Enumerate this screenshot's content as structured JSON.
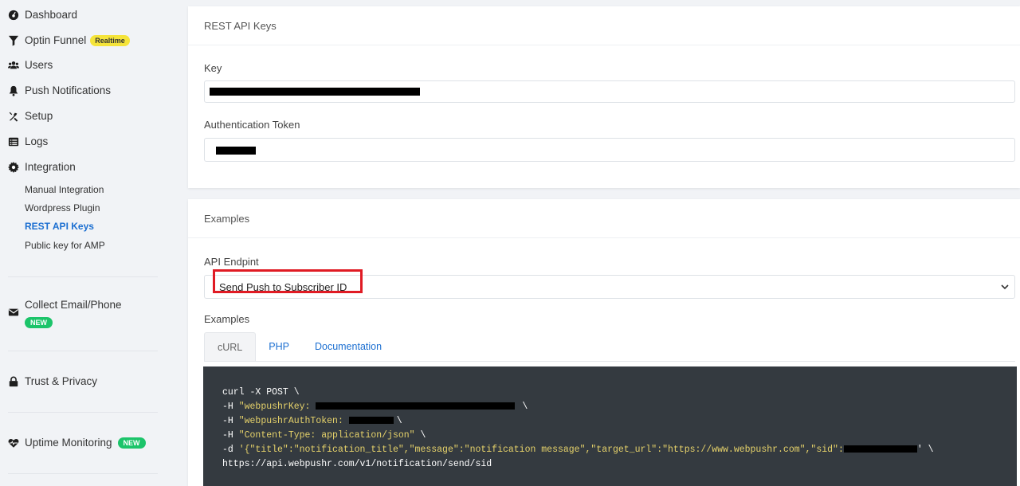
{
  "sidebar": {
    "dashboard": "Dashboard",
    "optin_funnel": "Optin Funnel",
    "optin_badge": "Realtime",
    "users": "Users",
    "push_notifications": "Push Notifications",
    "setup": "Setup",
    "logs": "Logs",
    "integration": "Integration",
    "sub_items": [
      "Manual Integration",
      "Wordpress Plugin",
      "REST API Keys",
      "Public key for AMP"
    ],
    "collect": "Collect Email/Phone",
    "collect_badge": "NEW",
    "trust": "Trust & Privacy",
    "uptime": "Uptime Monitoring",
    "uptime_badge": "NEW"
  },
  "keys_card": {
    "title": "REST API Keys",
    "key_label": "Key",
    "token_label": "Authentication Token"
  },
  "examples_card": {
    "title": "Examples",
    "endpoint_label": "API Endpint",
    "endpoint_value": "Send Push to Subscriber ID",
    "examples_label": "Examples",
    "tabs": [
      "cURL",
      "PHP",
      "Documentation"
    ],
    "code": {
      "l1": "curl -X POST \\",
      "l2_a": "-H ",
      "l2_b": "\"webpushrKey: ",
      "l2_c": "\\",
      "l3_a": "-H ",
      "l3_b": "\"webpushrAuthToken: ",
      "l3_c": "\\",
      "l4_a": "-H ",
      "l4_b": "\"Content-Type: application/json\"",
      "l4_c": " \\",
      "l5_a": "-d ",
      "l5_b": "'{\"title\":\"notification_title\",\"message\":\"notification message\",\"target_url\":\"https://www.webpushr.com\",\"sid\":",
      "l5_c": "' \\",
      "l6": "https://api.webpushr.com/v1/notification/send/sid"
    }
  },
  "colors": {
    "accent": "#1c6fd1",
    "highlight": "#e01b24",
    "badge_green": "#1cc46a",
    "badge_yellow": "#f5e43a",
    "code_bg": "#343a40"
  }
}
